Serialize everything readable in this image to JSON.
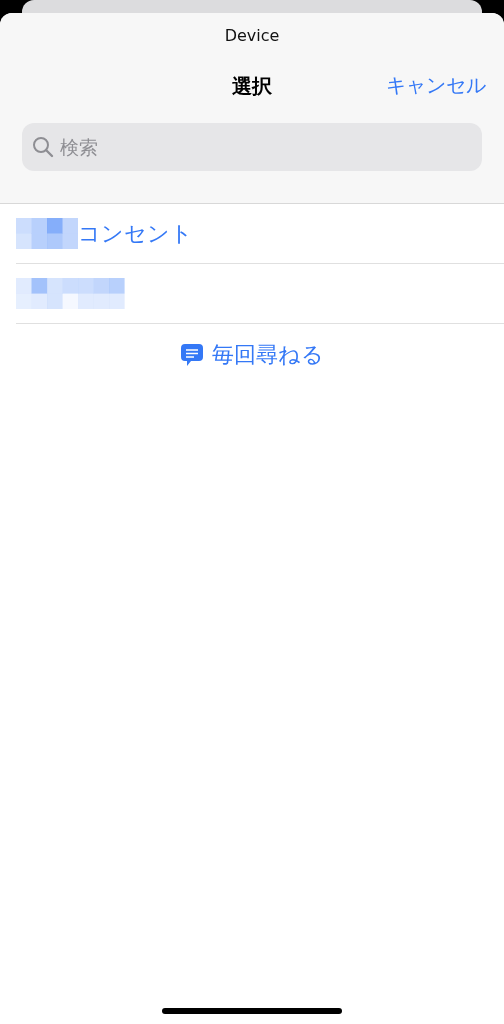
{
  "sheet": {
    "subtitle": "Device",
    "title": "選択",
    "cancel": "キャンセル"
  },
  "search": {
    "placeholder": "検索"
  },
  "items": [
    {
      "label": "コンセント",
      "redacted": true
    },
    {
      "redacted": true
    }
  ],
  "ask_every_time": {
    "label": "毎回尋ねる"
  }
}
